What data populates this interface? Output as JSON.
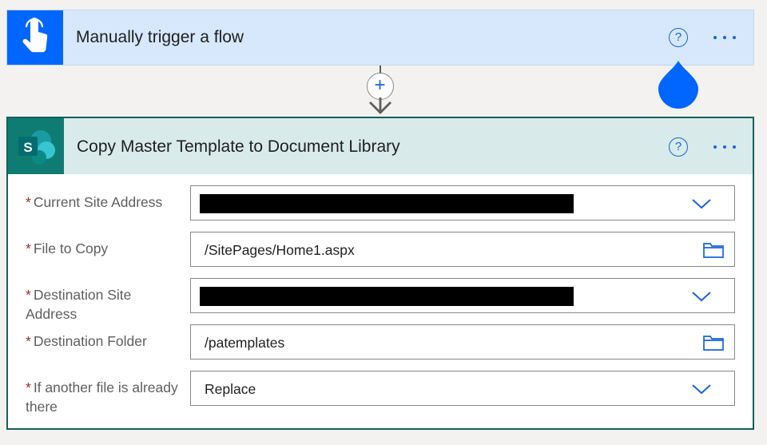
{
  "trigger": {
    "title": "Manually trigger a flow",
    "icon": "hand-touch-icon",
    "help_symbol": "?",
    "accent": "#0066ff"
  },
  "connector": {
    "add_symbol": "+"
  },
  "action": {
    "title": "Copy Master Template to Document Library",
    "icon": "sharepoint-icon",
    "help_symbol": "?",
    "accent": "#0f7c74",
    "required_marker": "*",
    "fields": [
      {
        "label": "Current Site Address",
        "value": "",
        "control": "dropdown",
        "redacted": true
      },
      {
        "label": "File to Copy",
        "value": "/SitePages/Home1.aspx",
        "control": "folder-picker",
        "redacted": false
      },
      {
        "label": "Destination Site Address",
        "value": "",
        "control": "dropdown",
        "redacted": true
      },
      {
        "label": "Destination Folder",
        "value": "/patemplates",
        "control": "folder-picker",
        "redacted": false
      },
      {
        "label": "If another file is already there",
        "value": "Replace",
        "control": "dropdown",
        "redacted": false
      }
    ]
  }
}
